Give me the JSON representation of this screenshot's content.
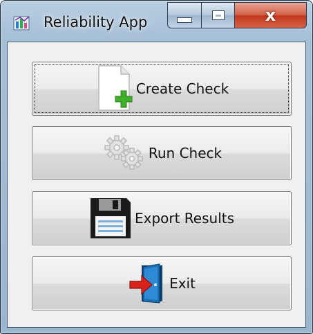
{
  "window": {
    "title": "Reliability App",
    "close_glyph": "x"
  },
  "buttons": [
    {
      "label": "Create Check",
      "icon": "new-document-plus-icon"
    },
    {
      "label": "Run Check",
      "icon": "gears-icon"
    },
    {
      "label": "Export Results",
      "icon": "floppy-disk-icon"
    },
    {
      "label": "Exit",
      "icon": "door-exit-icon"
    }
  ],
  "colors": {
    "close_button": "#c2361c",
    "plus_green": "#3fae2a",
    "exit_arrow": "#d8231b",
    "door_blue": "#1b6fb3"
  }
}
